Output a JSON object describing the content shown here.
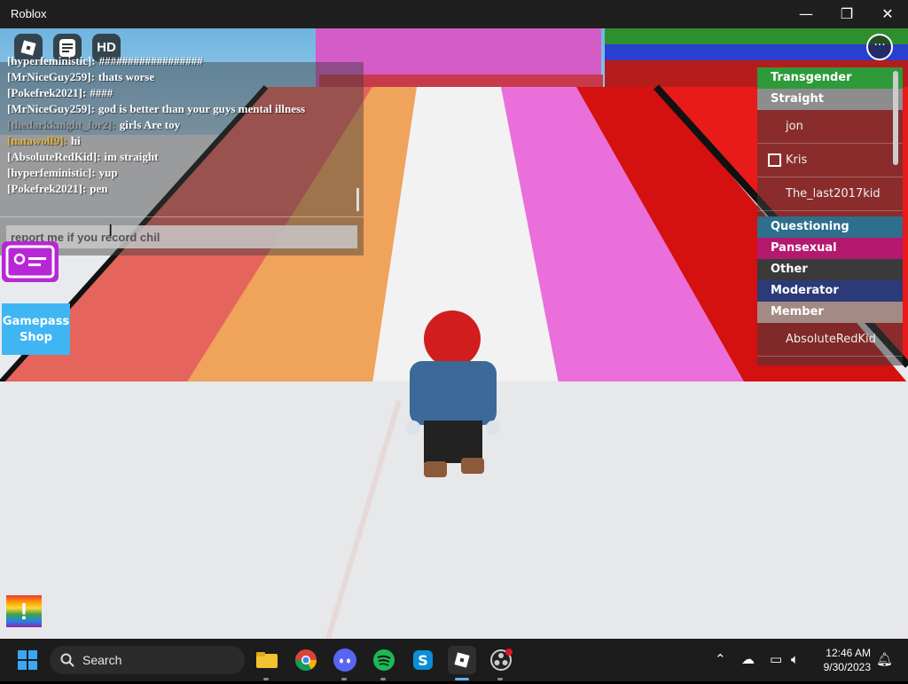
{
  "window": {
    "title": "Roblox",
    "minimize": "—",
    "restore": "❐",
    "close": "✕"
  },
  "toolbar": {
    "hd_label": "HD",
    "menu_label": "···"
  },
  "chat": {
    "messages": [
      {
        "name": "[hyperfeministic]:",
        "text": "##################",
        "color": "white"
      },
      {
        "name": "[MrNiceGuy259]:",
        "text": "thats worse",
        "color": "white"
      },
      {
        "name": "[Pokefrek2021]:",
        "text": "####",
        "color": "white"
      },
      {
        "name": "[MrNiceGuy259]:",
        "text": "god is better than your guys mental illness",
        "color": "white"
      },
      {
        "name": "[thedarkknight_for2]:",
        "text": "girls Are toy",
        "color": "gray"
      },
      {
        "name": "[natawolf9]:",
        "text": "hi",
        "color": "gold"
      },
      {
        "name": "[AbsoluteRedKid]:",
        "text": "im straight",
        "color": "white"
      },
      {
        "name": "[hyperfeministic]:",
        "text": "yup",
        "color": "white"
      },
      {
        "name": "[Pokefrek2021]:",
        "text": "pen",
        "color": "white"
      }
    ],
    "input_value": "report me if you record chil"
  },
  "gamepass": {
    "line1": "Gamepass",
    "line2": "Shop"
  },
  "rainbow_button": "!",
  "playerlist": {
    "teams": [
      {
        "name": "Transgender",
        "color": "#2e9a3a"
      },
      {
        "name": "Straight",
        "color": "#8d8d8d"
      },
      {
        "name": "Questioning",
        "color": "#2d6f8c"
      },
      {
        "name": "Pansexual",
        "color": "#b5186f"
      },
      {
        "name": "Other",
        "color": "#3a3a3a"
      },
      {
        "name": "Moderator",
        "color": "#2b3a78"
      },
      {
        "name": "Member",
        "color": "#a48a84"
      }
    ],
    "players": {
      "straight": [
        "jon",
        "Kris",
        "The_last2017kid"
      ],
      "member": [
        "AbsoluteRedKid"
      ]
    }
  },
  "taskbar": {
    "search_label": "Search",
    "time": "12:46 AM",
    "date": "9/30/2023",
    "apps": [
      {
        "name": "file-explorer",
        "color": "#f2c230"
      },
      {
        "name": "chrome",
        "color": "#3f8f3f"
      },
      {
        "name": "discord",
        "color": "#5865f2"
      },
      {
        "name": "spotify",
        "color": "#1db954"
      },
      {
        "name": "skype",
        "color": "#0a8ed8"
      },
      {
        "name": "roblox",
        "color": "#3a3a3a"
      },
      {
        "name": "obs",
        "color": "#2a2a2a"
      }
    ]
  }
}
